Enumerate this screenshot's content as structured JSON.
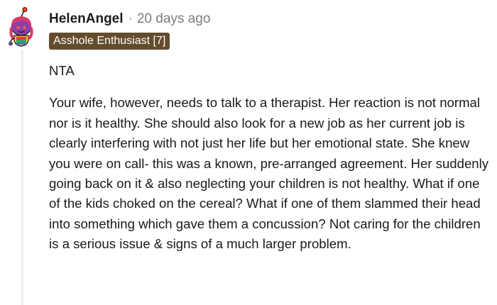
{
  "comment": {
    "author": "HelenAngel",
    "separator": "·",
    "timestamp": "20 days ago",
    "flair": "Asshole Enthusiast [7]",
    "avatar_icon": "snoo-avatar-icon",
    "paragraphs": [
      "NTA",
      "Your wife, however, needs to talk to a therapist. Her reaction is not normal nor is it healthy. She should also look for a new job as her current job is clearly interfering with not just her life but her emotional state. She knew you were on call- this was a known, pre-arranged agreement. Her suddenly going back on it & also neglecting your children is not healthy. What if one of the kids choked on the cereal? What if one of them slammed their head into something which gave them a concussion? Not caring for the children is a serious issue & signs of a much larger problem."
    ]
  },
  "colors": {
    "flair_background": "#634c2c",
    "flair_text": "#ffffff",
    "username": "#1c1c1c",
    "timestamp": "#7c7c7c",
    "body_text": "#1a1a1b",
    "thread_line": "#edeff1"
  }
}
